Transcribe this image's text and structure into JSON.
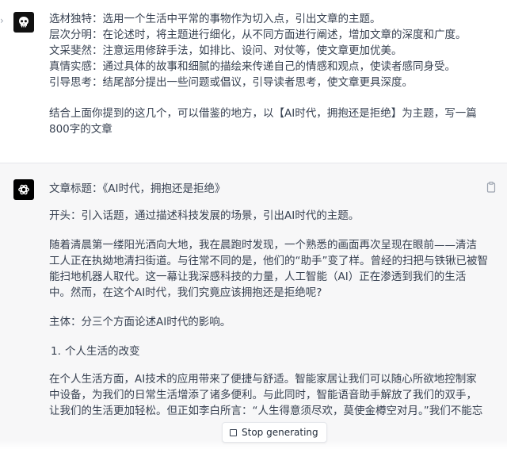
{
  "user": {
    "lines": [
      "选材独特：选用一个生活中平常的事物作为切入点，引出文章的主题。",
      "层次分明：在论述时，将主题进行细化，从不同方面进行阐述，增加文章的深度和广度。",
      "文采斐然：注意运用修辞手法，如排比、设问、对仗等，使文章更加优美。",
      "真情实感：通过具体的故事和细腻的描绘来传递自己的情感和观点，使读者感同身受。",
      "引导思考：结尾部分提出一些问题或倡议，引导读者思考，使文章更具深度。"
    ],
    "request_lines": [
      "结合上面你提到的这几个，可以借鉴的地方，以【AI时代，拥抱还是拒绝】为主题，写一篇",
      "800字的文章"
    ]
  },
  "assistant": {
    "title_line": "文章标题：《AI时代，拥抱还是拒绝》",
    "opening_line": "开头：引入话题，通过描述科技发展的场景，引出AI时代的主题。",
    "para1_lines": [
      "随着清晨第一缕阳光洒向大地，我在晨跑时发现，一个熟悉的画面再次呈现在眼前——清洁",
      "工人正在执拗地清扫街道。与往常不同的是，他们的“助手”变了样。曾经的扫把与铁锹已被智",
      "能扫地机器人取代。这一幕让我深感科技的力量，人工智能（AI）正在渗透到我们的生活",
      "中。然而，在这个AI时代，我们究竟应该拥抱还是拒绝呢?"
    ],
    "body_line": "主体：分三个方面论述AI时代的影响。",
    "list_item": {
      "num": "1.",
      "text": "个人生活的改变"
    },
    "para2_lines": [
      "在个人生活方面，AI技术的应用带来了便捷与舒适。智能家居让我们可以随心所欲地控制家",
      "中设备，为我们的日常生活增添了诸多便利。与此同时，智能语音助手解放了我们的双手，",
      "让我们的生活更加轻松。但正如李白所言：“人生得意须尽欢，莫使金樽空对月。”我们不能忘"
    ]
  },
  "stop_button": {
    "label": "Stop generating"
  },
  "colors": {
    "text": "#374151",
    "assistant_bg": "#f7f7f8",
    "avatar_bg": "#000000"
  }
}
